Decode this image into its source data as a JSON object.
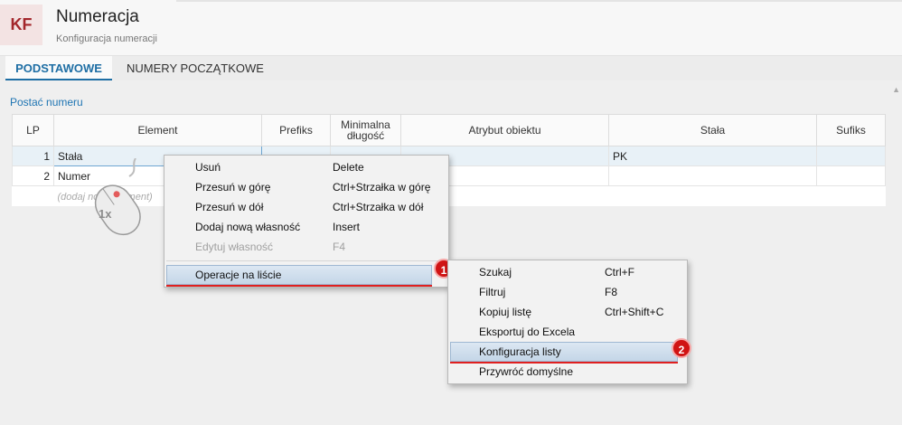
{
  "app": {
    "logo": "KF",
    "title": "Numeracja",
    "subtitle": "Konfiguracja numeracji"
  },
  "tabs": [
    {
      "label": "PODSTAWOWE",
      "active": true
    },
    {
      "label": "NUMERY POCZĄTKOWE",
      "active": false
    }
  ],
  "section_label": "Postać numeru",
  "grid": {
    "columns": [
      "LP",
      "Element",
      "Prefiks",
      "Minimalna\ndługość",
      "Atrybut obiektu",
      "Stała",
      "Sufiks"
    ],
    "rows": [
      {
        "lp": "1",
        "element": "Stała",
        "prefix": "",
        "min_len": "",
        "attr": "",
        "const": "PK",
        "suffix": ""
      },
      {
        "lp": "2",
        "element": "Numer",
        "prefix": "",
        "min_len": "",
        "attr": "",
        "const": "",
        "suffix": ""
      }
    ],
    "add_hint": "(dodaj nowy element)"
  },
  "context_menu": {
    "items": [
      {
        "label": "Usuń",
        "shortcut": "Delete"
      },
      {
        "label": "Przesuń w górę",
        "shortcut": "Ctrl+Strzałka w górę"
      },
      {
        "label": "Przesuń w dół",
        "shortcut": "Ctrl+Strzałka w dół"
      },
      {
        "label": "Dodaj nową własność",
        "shortcut": "Insert"
      },
      {
        "label": "Edytuj własność",
        "shortcut": "F4",
        "disabled": true
      }
    ],
    "submenu_label": "Operacje na liście"
  },
  "submenu": {
    "items": [
      {
        "label": "Szukaj",
        "shortcut": "Ctrl+F"
      },
      {
        "label": "Filtruj",
        "shortcut": "F8"
      },
      {
        "label": "Kopiuj listę",
        "shortcut": "Ctrl+Shift+C"
      },
      {
        "label": "Eksportuj do Excela",
        "shortcut": ""
      },
      {
        "label": "Konfiguracja listy",
        "shortcut": "",
        "highlighted": true
      },
      {
        "label": "Przywróć domyślne",
        "shortcut": ""
      }
    ]
  },
  "badges": {
    "first": "1",
    "second": "2"
  },
  "mouse_hint": "1x",
  "colors": {
    "accent": "#1e6ea4",
    "logo_text": "#a3262b",
    "badge": "#d01414"
  }
}
